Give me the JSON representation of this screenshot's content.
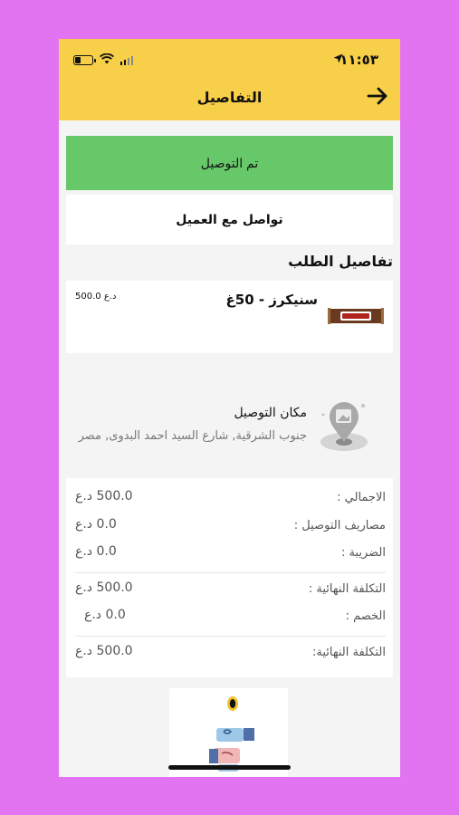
{
  "status_bar": {
    "time": "١١:٥٣",
    "location_icon": "location-arrow-icon",
    "wifi_icon": "wifi-icon",
    "battery_icon": "battery-icon",
    "signal_icon": "signal-icon"
  },
  "header": {
    "title": "التفاصيل",
    "back_icon": "arrow-right-icon",
    "bg_color": "#f8cf48"
  },
  "actions": {
    "delivered_label": "تم التوصيل",
    "delivered_color": "#67c86a",
    "contact_customer_label": "تواصل مع العميل"
  },
  "order_details": {
    "section_title": "تفاصيل الطلب",
    "items": [
      {
        "name": "سنيكرز - 50غ",
        "price": "500.0 د.ع",
        "image_icon": "snickers-bar-image"
      }
    ]
  },
  "delivery": {
    "title": "مكان التوصيل",
    "address": "جنوب الشرقية, شارع السيد احمد البدوى, مصر",
    "icon": "map-pin-icon"
  },
  "totals": {
    "rows": [
      {
        "label": "الاجمالي :",
        "value": "500.0 د.ع"
      },
      {
        "label": "مصاريف التوصيل :",
        "value": "0.0 د.ع"
      },
      {
        "label": "الضريبة :",
        "value": "0.0 د.ع"
      },
      {
        "label": "التكلفة النهائية :",
        "value": "500.0 د.ع"
      },
      {
        "label": "الخصم :",
        "value": "0.0 د.ع"
      },
      {
        "label": "التكلفة النهائية:",
        "value": "500.0 د.ع"
      }
    ]
  },
  "footer": {
    "illustration": "payment-handover-illustration"
  }
}
